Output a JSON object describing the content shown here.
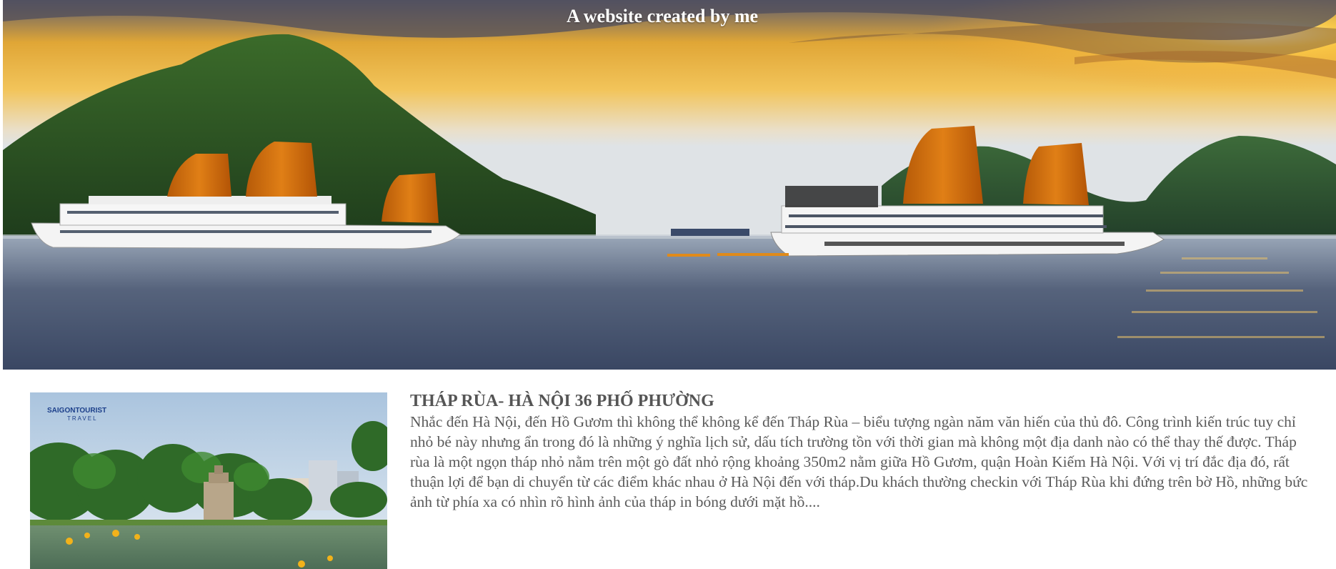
{
  "hero": {
    "title": "A website created by me",
    "image_alt": "Ha Long Bay cruise ships with orange sails at sunset"
  },
  "thumbnail": {
    "logo_text": "SAIGONTOURIST",
    "logo_sub": "TRAVEL",
    "image_alt": "Thap Rua tower on Hoan Kiem lake"
  },
  "article": {
    "title": "THÁP RÙA- HÀ NỘI 36 PHỐ PHƯỜNG",
    "body": "Nhắc đến Hà Nội, đến Hồ Gươm thì không thể không kể đến Tháp Rùa – biểu tượng ngàn năm văn hiến của thủ đô. Công trình kiến trúc tuy chỉ nhỏ bé này nhưng ẩn trong đó là những ý nghĩa lịch sử, dấu tích trường tồn với thời gian mà không một địa danh nào có thể thay thế được. Tháp rùa là một ngọn tháp nhỏ nằm trên một gò đất nhỏ rộng khoảng 350m2 nằm giữa Hồ Gươm, quận Hoàn Kiếm Hà Nội. Với vị trí đắc địa đó, rất thuận lợi để bạn di chuyển từ các điểm khác nhau ở Hà Nội đến với tháp.Du khách thường checkin với Tháp Rùa khi đứng trên bờ Hồ, những bức ảnh từ phía xa có nhìn rõ hình ảnh của tháp in bóng dưới mặt hồ...."
  },
  "colors": {
    "title_text": "#ffffff",
    "article_text": "#555555",
    "sail": "#d9730f"
  }
}
